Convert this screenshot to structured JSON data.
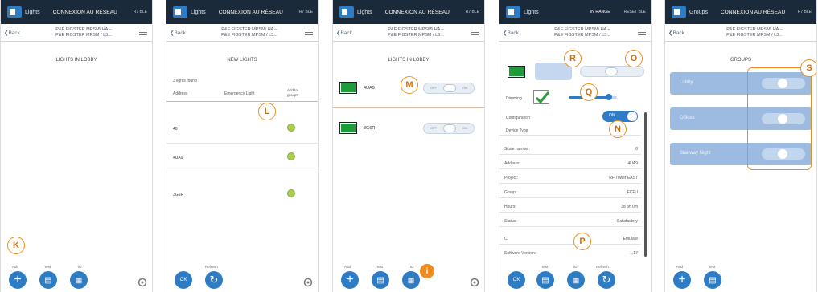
{
  "common": {
    "app_name": "Lights",
    "connection": "CONNEXION AU RÉSEAU",
    "version": "R7 BLE",
    "back": "Back",
    "path_line1": "P&E FIGSTER MPSM\\ HA –",
    "path_line2": "P&E FIGSTER MPSM / L3..."
  },
  "screen1": {
    "title": "LIGHTS IN LOBBY",
    "buttons": [
      {
        "label": "Add",
        "glyph": "+"
      },
      {
        "label": "Test",
        "glyph": "▤"
      },
      {
        "label": "ID",
        "glyph": "▦"
      }
    ],
    "marker": "K"
  },
  "screen2": {
    "title": "NEW LIGHTS",
    "subtitle": "3 lights found",
    "col_address": "Address",
    "col_type": "Emergency Light",
    "col_add": "Add to group?",
    "rows": [
      {
        "address": "40"
      },
      {
        "address": "4UA9"
      },
      {
        "address": "3G6R"
      }
    ],
    "buttons": [
      {
        "label": "",
        "glyph": "OK"
      },
      {
        "label": "Refresh",
        "glyph": "↻"
      }
    ],
    "marker": "L"
  },
  "screen3": {
    "title": "LIGHTS IN LOBBY",
    "lights": [
      {
        "name": "4UA9"
      },
      {
        "name": "3G6R"
      }
    ],
    "toggle_off": "OFF",
    "toggle_on": "ON",
    "buttons": [
      {
        "label": "Add",
        "glyph": "+"
      },
      {
        "label": "Test",
        "glyph": "▤"
      },
      {
        "label": "ID",
        "glyph": "▦"
      }
    ],
    "marker_m": "M",
    "marker_i": "i"
  },
  "screen4": {
    "connection": "IN RANGE",
    "version": "RESET BLE",
    "dimming_label": "Dimming",
    "config_label": "Configuration",
    "config_toggle": "ON",
    "device_type": "Device Type",
    "rows": [
      {
        "k": "Scale number:",
        "v": "0"
      },
      {
        "k": "Address:",
        "v": "4UA9"
      },
      {
        "k": "Project:",
        "v": "RF Tower EAST"
      },
      {
        "k": "Group:",
        "v": "FCFU"
      },
      {
        "k": "Hours:",
        "v": "3d 3h 0m"
      },
      {
        "k": "Status:",
        "v": "Satisfactory"
      },
      {
        "k": "C:",
        "v": "Emulate"
      },
      {
        "k": "Software Version:",
        "v": "1.17"
      }
    ],
    "buttons": [
      {
        "label": "",
        "glyph": "OK"
      },
      {
        "label": "Test",
        "glyph": "▤"
      },
      {
        "label": "ID",
        "glyph": "▦"
      },
      {
        "label": "Refresh",
        "glyph": "↻"
      }
    ],
    "markers": [
      "R",
      "O",
      "Q",
      "N",
      "P"
    ]
  },
  "screen5": {
    "app_name": "Groups",
    "title": "GROUPS",
    "groups": [
      {
        "name": "Lobby"
      },
      {
        "name": "Offices"
      },
      {
        "name": "Stairway Night"
      }
    ],
    "buttons": [
      {
        "label": "Add",
        "glyph": "+"
      },
      {
        "label": "Test",
        "glyph": "▤"
      }
    ],
    "marker": "S"
  },
  "colors": {
    "topbar": "#1b2a3a",
    "accent": "#2e7cc4",
    "marker": "#f08c1d",
    "group_row": "#9dbbe0"
  }
}
